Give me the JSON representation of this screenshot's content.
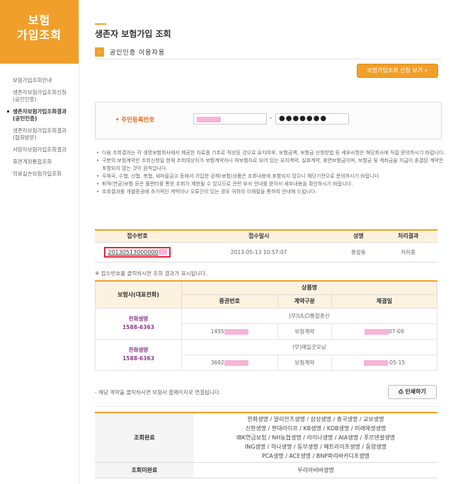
{
  "sidebar": {
    "title_line1": "보험",
    "title_line2": "가입조회",
    "items": [
      {
        "label": "보험가입조회안내"
      },
      {
        "label": "생존자보험가입조회신청 (공인인증)"
      },
      {
        "label": "생존자보험가입조회결과 (공인인증)"
      },
      {
        "label": "생존자보험가입조회결과 (협회방문)"
      },
      {
        "label": "사망자보험가입조회결과"
      },
      {
        "label": "휴면계좌통합조회"
      },
      {
        "label": "의료실손보험가입조회"
      }
    ]
  },
  "main": {
    "title": "생존자 보험가입 조회",
    "cert_label": "공인인증 이용자용",
    "apply_button": "보험가입조회 신청 보기 »",
    "rrn_label": "주민등록번호",
    "rrn_dash": "-",
    "rrn_back": "●●●●●●●",
    "notes": [
      "다음 조회결과는 각 생명보험회사에서 제공한 자료를 기초로 작성된 것으로 유지여부, 보험금액, 보험금 신청방법 등 세부사항은 해당회사에 직접 문의하시기 바랍니다.",
      "구분의 보험계약은 조회신청일 현재 조회대상자가 보험계약자나 피보험자로 되어 있는 유지계약, 실효계약, 휴면보험금이며, 보험금 및 계좌금을 지급이 종결된 계약은 포함되지 않는 것이 원칙입니다.",
      "우체국, 수협, 신협, 축협, 새마을금고 등에서 가입한 공제(보험)상품은 조회내용에 포함되지 않으니 해당기관으로 문의하시기 바랍니다.",
      "퇴직(연금)보험 등은 플랜터를 통한 조회가 제한될 수 있으므로 관련 부서 안내를 받아서 세부내용을 확인하시기 바랍니다.",
      "조회결과를 개별증권에 추가적인 계약이나 오류건이 있는 경우 귀하의 이해말을 통하여 안내해 드립니다."
    ],
    "receipt_table": {
      "headers": [
        "접수번호",
        "접수일시",
        "성명",
        "처리결과"
      ],
      "row": {
        "receipt_no": "20130513000000",
        "date": "2013-05-13 10:57:07",
        "name": "홍길동",
        "status": "처리중"
      }
    },
    "receipt_note": "※ 접수번호를 클릭하시면 조회 결과가 표시됩니다.",
    "result_table": {
      "h_insurer": "보험사(대표전화)",
      "h_product": "상품명",
      "h_policy": "증권번호",
      "h_type": "계약구분",
      "h_date": "체결일",
      "rows": [
        {
          "insurer": "한화생명",
          "phone": "1588-6363",
          "product": "(무)ULCI통합종신",
          "policy": "1495",
          "type": "보험계약",
          "date": "07-09"
        },
        {
          "insurer": "한화생명",
          "phone": "1588-6363",
          "product": "(무)매일굿모닝",
          "policy": "3692",
          "type": "보험계약",
          "date": "-05-15"
        }
      ]
    },
    "link_note": "- 해당 계약을 클릭하시면 보험사 홈페이지로 연결됩니다.",
    "print_button": "인쇄하기",
    "status_table": {
      "done_label": "조회완료",
      "done_lines": [
        "한화생명 / 알리안츠생명 / 삼성생명 / 흥국생명 / 교보생명",
        "신한생명 / 현대라이프 / KB생명 / KDB생명 / 미래에셋생명",
        "IBK연금보험 / NH농협생명 / 라이나생명 / AIA생명 / 푸르덴셜생명",
        "ING생명 / 하나생명 / 동부생명 / 메트라이프생명 / 동양생명",
        "PCA생명 / ACE생명 / BNP파리바카디프생명"
      ],
      "pending_label": "조회미완료",
      "pending_value": "우리아비바생명"
    }
  }
}
